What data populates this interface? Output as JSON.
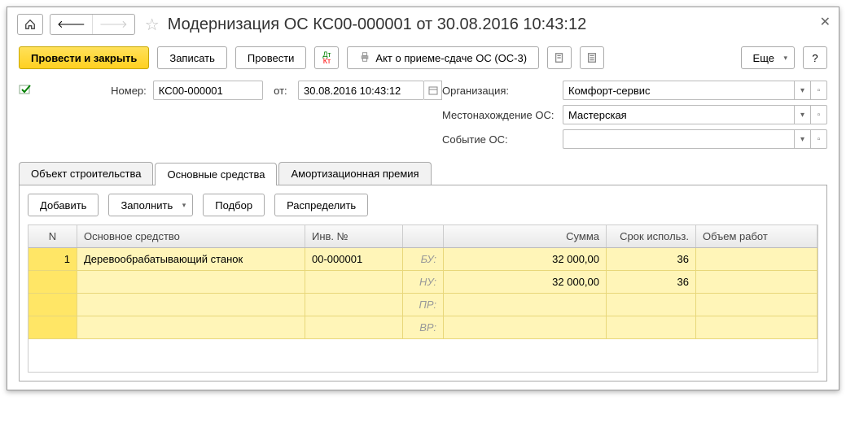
{
  "title": "Модернизация ОС КС00-000001 от 30.08.2016 10:43:12",
  "toolbar": {
    "post_close": "Провести и закрыть",
    "save": "Записать",
    "post": "Провести",
    "act": "Акт о приеме-сдаче ОС (ОС-3)",
    "more": "Еще",
    "help": "?"
  },
  "form": {
    "number_label": "Номер:",
    "number_value": "КС00-000001",
    "from_label": "от:",
    "date_value": "30.08.2016 10:43:12",
    "org_label": "Организация:",
    "org_value": "Комфорт-сервис",
    "location_label": "Местонахождение ОС:",
    "location_value": "Мастерская",
    "event_label": "Событие ОС:",
    "event_value": ""
  },
  "tabs": {
    "t1": "Объект строительства",
    "t2": "Основные средства",
    "t3": "Амортизационная премия"
  },
  "tab_toolbar": {
    "add": "Добавить",
    "fill": "Заполнить",
    "pick": "Подбор",
    "distribute": "Распределить"
  },
  "grid": {
    "headers": {
      "n": "N",
      "name": "Основное средство",
      "inv": "Инв. №",
      "sum": "Сумма",
      "term": "Срок использ.",
      "work": "Объем работ"
    },
    "row": {
      "n": "1",
      "name": "Деревообрабатывающий станок",
      "inv": "00-000001",
      "lines": [
        {
          "type": "БУ:",
          "sum": "32 000,00",
          "term": "36"
        },
        {
          "type": "НУ:",
          "sum": "32 000,00",
          "term": "36"
        },
        {
          "type": "ПР:",
          "sum": "",
          "term": ""
        },
        {
          "type": "ВР:",
          "sum": "",
          "term": ""
        }
      ]
    }
  }
}
